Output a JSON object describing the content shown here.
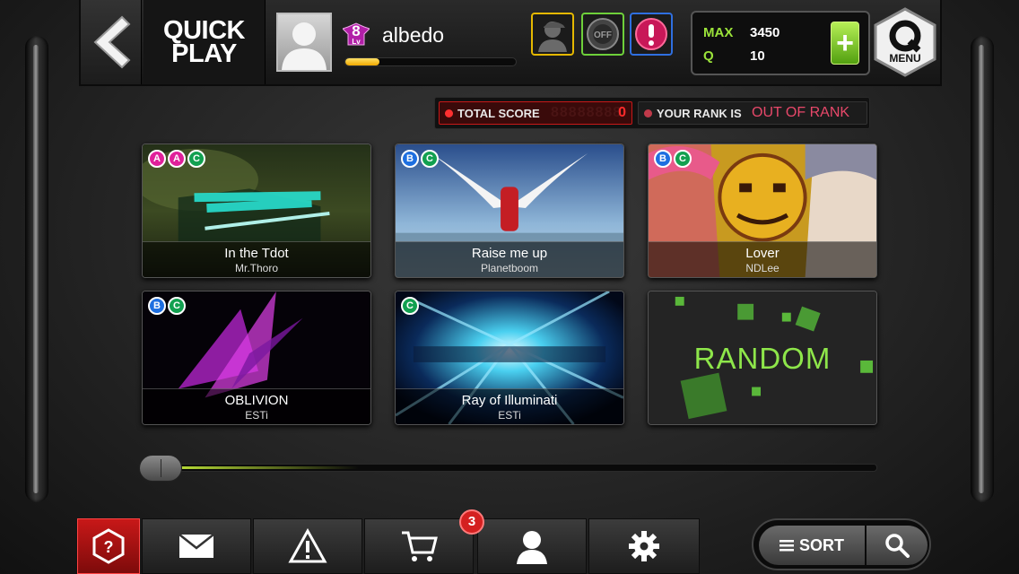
{
  "header": {
    "title_line1": "QUICK",
    "title_line2": "PLAY"
  },
  "profile": {
    "username": "albedo",
    "level": "8",
    "level_suffix": "Lv",
    "exp_fraction": 0.2
  },
  "points": {
    "max_label": "MAX",
    "max_value": "3450",
    "q_label": "Q",
    "q_value": "10",
    "plus_label": "+"
  },
  "menu": {
    "label": "MENU"
  },
  "score": {
    "total_label": "TOTAL SCORE",
    "total_ghost": "88888888",
    "total_value": "0",
    "rank_label": "YOUR RANK IS",
    "rank_value": "OUT OF RANK"
  },
  "songs": [
    {
      "title": "In the Tdot",
      "artist": "Mr.Thoro",
      "difficulties": [
        "A",
        "A",
        "C"
      ]
    },
    {
      "title": "Raise me up",
      "artist": "Planetboom",
      "difficulties": [
        "B",
        "C"
      ]
    },
    {
      "title": "Lover",
      "artist": "NDLee",
      "difficulties": [
        "B",
        "C"
      ]
    },
    {
      "title": "OBLIVION",
      "artist": "ESTi",
      "difficulties": [
        "B",
        "C"
      ]
    },
    {
      "title": "Ray of Illuminati",
      "artist": "ESTi",
      "difficulties": [
        "C"
      ]
    }
  ],
  "random": {
    "label": "RANDOM"
  },
  "scroll": {
    "position_fraction": 0.0
  },
  "bottom_nav": {
    "shop_badge": "3",
    "sort_label": "SORT"
  },
  "colors": {
    "accent_green": "#8ee64a",
    "danger_red": "#c81818",
    "diff_A": "#e0209a",
    "diff_B": "#1e6fe0",
    "diff_C": "#12a050"
  },
  "icons": [
    "back-arrow-icon",
    "avatar-silhouette-icon",
    "level-badge-icon",
    "character-icon",
    "off-toggle-icon",
    "alert-mode-icon",
    "q-menu-icon",
    "help-icon",
    "mail-icon",
    "warning-icon",
    "cart-icon",
    "profile-icon",
    "gear-icon",
    "sort-list-icon",
    "search-icon"
  ]
}
